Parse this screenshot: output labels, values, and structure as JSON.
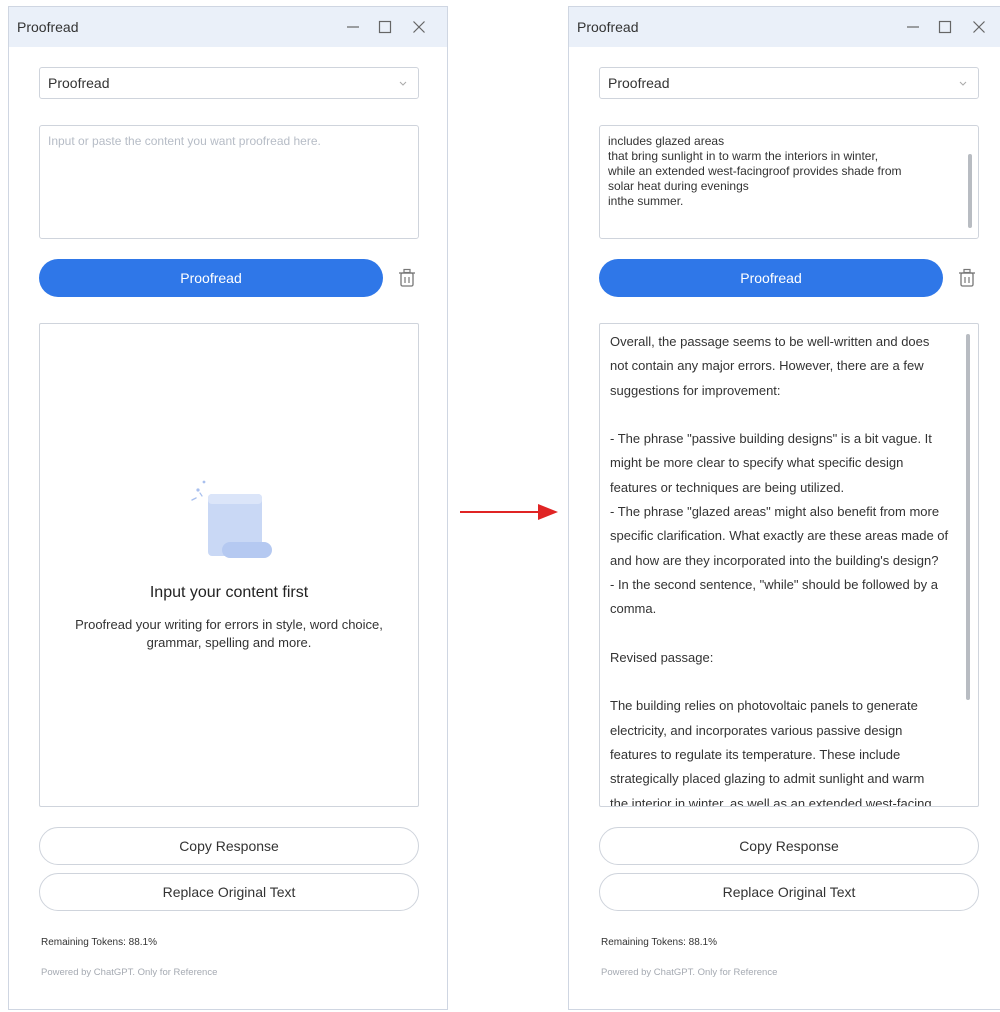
{
  "app_title": "Proofread",
  "colors": {
    "accent": "#2f77e8",
    "arrow": "#e02424",
    "titlebar": "#eaf0f9"
  },
  "icons": {
    "minimize": "minimize-icon",
    "maximize": "maximize-icon",
    "close": "close-icon",
    "dropdown": "chevron-down-icon",
    "trash": "trash-icon",
    "empty_state": "document-icon"
  },
  "left": {
    "mode_select": "Proofread",
    "input_placeholder": "Input or paste the content you want proofread here.",
    "proofread_button": "Proofread",
    "empty_title": "Input your content first",
    "empty_desc": "Proofread your writing for errors in style, word choice, grammar, spelling and more.",
    "copy_button": "Copy Response",
    "replace_button": "Replace Original Text",
    "remaining_tokens": "Remaining Tokens: 88.1%",
    "powered_by": "Powered by ChatGPT. Only for Reference"
  },
  "right": {
    "mode_select": "Proofread",
    "input_lines": [
      "includes glazed areas",
      "that bring sunlight in to warm the interiors in winter,",
      "while an extended west-facingroof provides shade from",
      "solar heat during evenings",
      "inthe summer."
    ],
    "proofread_button": "Proofread",
    "result_lines": [
      "Overall, the passage seems to be well-written and does",
      "not contain any major errors. However, there are a few",
      "suggestions for improvement:",
      "",
      "- The phrase \"passive building designs\" is a bit vague. It",
      "might be more clear to specify what specific design",
      "features or techniques are being utilized.",
      "- The phrase \"glazed areas\" might also benefit from more",
      "specific clarification. What exactly are these areas made of",
      "and how are they incorporated into the building's design?",
      "- In the second sentence, \"while\" should be followed by a",
      "comma.",
      "",
      "Revised passage:",
      "",
      "The building relies on photovoltaic panels to generate",
      "electricity, and incorporates various passive design",
      "features to regulate its temperature. These include",
      "strategically placed glazing to admit sunlight and warm",
      "the interior in winter, as well as an extended west-facing"
    ],
    "copy_button": "Copy Response",
    "replace_button": "Replace Original Text",
    "remaining_tokens": "Remaining Tokens: 88.1%",
    "powered_by": "Powered by ChatGPT. Only for Reference"
  }
}
